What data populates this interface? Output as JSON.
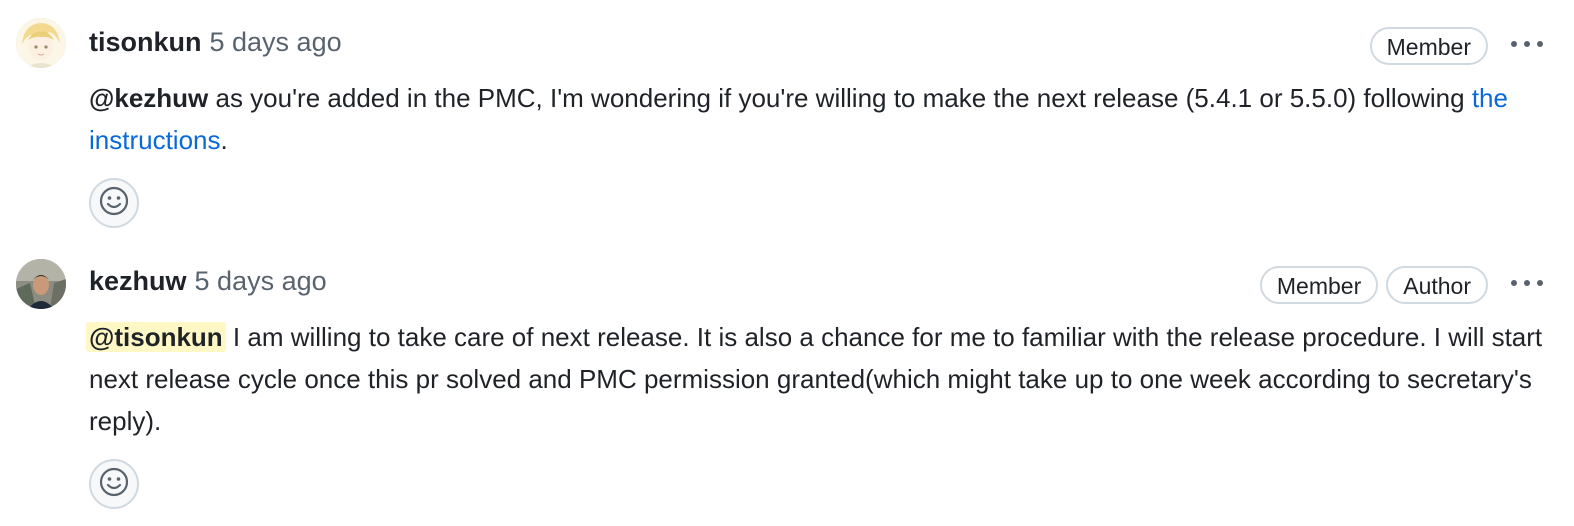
{
  "comments": [
    {
      "author": "tisonkun",
      "time": "5 days ago",
      "badges": [
        "Member"
      ],
      "body": {
        "mention": "@kezhuw",
        "text_before_link": " as you're added in the PMC, I'm wondering if you're willing to make the next release (5.4.1 or 5.5.0) following ",
        "link_text": "the instructions",
        "text_after_link": "."
      }
    },
    {
      "author": "kezhuw",
      "time": "5 days ago",
      "badges": [
        "Member",
        "Author"
      ],
      "body": {
        "mention": "@tisonkun",
        "text": " I am willing to take care of next release. It is also a chance for me to familiar with the release procedure. I will start next release cycle once this pr solved and PMC permission granted(which might take up to one week according to secretary's reply)."
      }
    }
  ],
  "icons": {
    "more": "kebab-horizontal-icon",
    "reaction": "smiley-icon"
  },
  "colors": {
    "link": "#0969da",
    "mention_highlight": "#fff8c5",
    "muted": "#59636e",
    "border": "#d1d9e0"
  }
}
